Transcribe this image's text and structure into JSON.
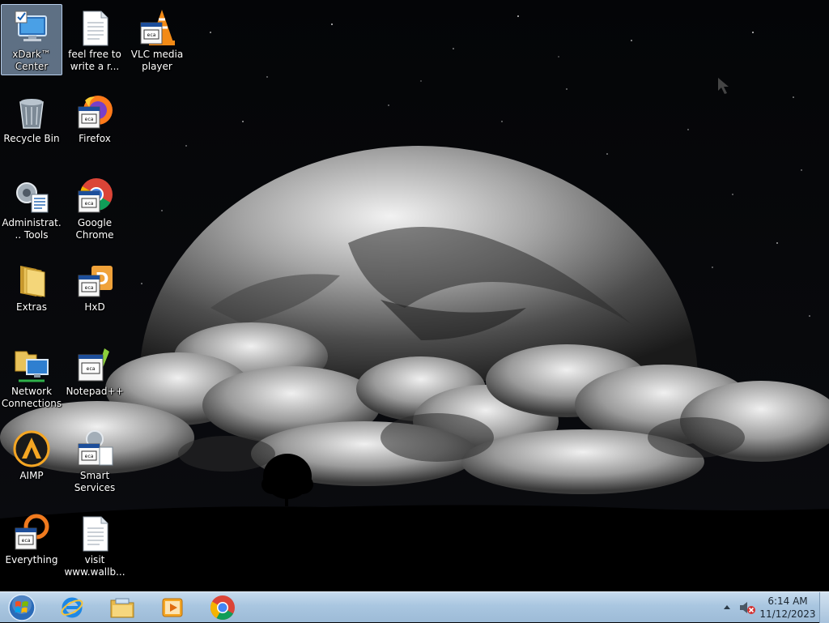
{
  "desktop": {
    "icons": [
      {
        "label": "xDark™ Center"
      },
      {
        "label": "feel free to write a r..."
      },
      {
        "label": "VLC media player"
      },
      {
        "label": "Recycle Bin"
      },
      {
        "label": "Firefox"
      },
      {
        "label": "Administrat... Tools"
      },
      {
        "label": "Google Chrome"
      },
      {
        "label": "Extras"
      },
      {
        "label": "HxD"
      },
      {
        "label": "Network Connections"
      },
      {
        "label": "Notepad++"
      },
      {
        "label": "AIMP"
      },
      {
        "label": "Smart Services"
      },
      {
        "label": "Everything"
      },
      {
        "label": "visit www.wallb..."
      }
    ]
  },
  "taskbar": {
    "pinned": [
      {
        "icon": "internet-explorer-icon"
      },
      {
        "icon": "file-explorer-icon"
      },
      {
        "icon": "media-player-icon"
      },
      {
        "icon": "chrome-icon"
      }
    ],
    "clock": {
      "time": "6:14 AM",
      "date": "11/12/2023"
    }
  },
  "colors": {
    "taskbar": "#a9c6e0",
    "selection": "#aac8eb",
    "label_text": "#ffffff"
  }
}
